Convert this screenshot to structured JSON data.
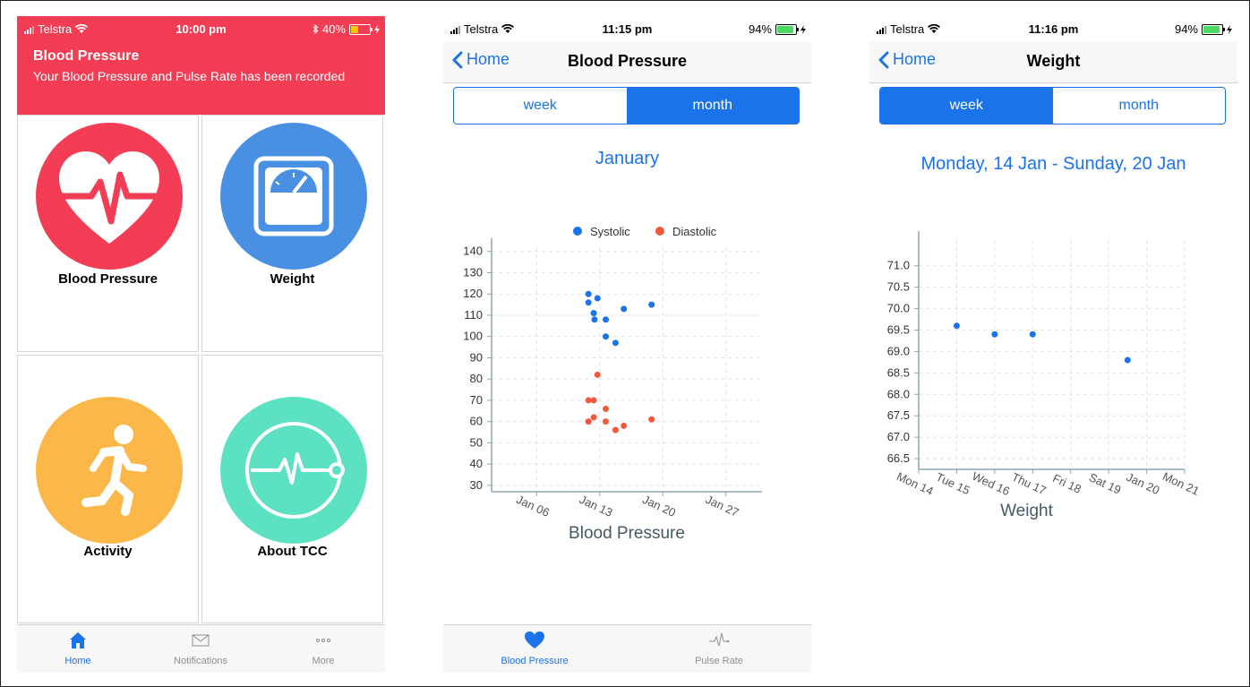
{
  "colors": {
    "accent": "#1a73e8",
    "banner": "#f23d55",
    "systolic": "#1a73e8",
    "diastolic": "#f2583e",
    "tile_bp": "#f23d55",
    "tile_weight": "#4a90e2",
    "tile_activity": "#fbb848",
    "tile_tcc": "#5ce1c2",
    "battery_low": "#ffc700",
    "battery_ok": "#4cd964"
  },
  "screens": [
    {
      "status": {
        "carrier": "Telstra",
        "time": "10:00 pm",
        "battery": "40%",
        "bluetooth": "bluetooth-icon"
      },
      "banner": {
        "title": "Blood Pressure",
        "message": "Your Blood Pressure and Pulse Rate has been recorded"
      },
      "tiles": [
        {
          "label": "Blood Pressure",
          "icon": "heart-pulse-icon"
        },
        {
          "label": "Weight",
          "icon": "scale-icon"
        },
        {
          "label": "Activity",
          "icon": "runner-icon"
        },
        {
          "label": "About TCC",
          "icon": "ecg-circle-icon"
        }
      ],
      "tabs": [
        {
          "label": "Home",
          "icon": "home-icon",
          "active": true
        },
        {
          "label": "Notifications",
          "icon": "envelope-icon",
          "active": false
        },
        {
          "label": "More",
          "icon": "more-icon",
          "active": false
        }
      ]
    },
    {
      "status": {
        "carrier": "Telstra",
        "time": "11:15 pm",
        "battery": "94%"
      },
      "nav": {
        "back": "Home",
        "title": "Blood Pressure"
      },
      "segment": [
        {
          "label": "week",
          "selected": false
        },
        {
          "label": "month",
          "selected": true
        }
      ],
      "period": "January",
      "tabs": [
        {
          "label": "Blood Pressure",
          "icon": "heart-icon",
          "active": true
        },
        {
          "label": "Pulse Rate",
          "icon": "pulse-icon",
          "active": false
        }
      ]
    },
    {
      "status": {
        "carrier": "Telstra",
        "time": "11:16 pm",
        "battery": "94%"
      },
      "nav": {
        "back": "Home",
        "title": "Weight"
      },
      "segment": [
        {
          "label": "week",
          "selected": true
        },
        {
          "label": "month",
          "selected": false
        }
      ],
      "period": "Monday, 14 Jan - Sunday, 20 Jan"
    }
  ],
  "chart_data": [
    {
      "type": "scatter",
      "title": "Blood Pressure",
      "xlabel": "Blood Pressure",
      "x_ticks": [
        "Jan 06",
        "Jan 13",
        "Jan 20",
        "Jan 27"
      ],
      "y_ticks": [
        30,
        40,
        50,
        60,
        70,
        80,
        90,
        100,
        110,
        120,
        130,
        140
      ],
      "ylim": [
        27,
        142
      ],
      "xlim": [
        "2019-01-01",
        "2019-01-31"
      ],
      "grid": true,
      "legend": "top",
      "series": [
        {
          "name": "Systolic",
          "color": "#1a73e8",
          "points": [
            {
              "x": "2019-01-11T18:00",
              "y": 120
            },
            {
              "x": "2019-01-11T18:00",
              "y": 116
            },
            {
              "x": "2019-01-12T08:00",
              "y": 111
            },
            {
              "x": "2019-01-12T10:00",
              "y": 108
            },
            {
              "x": "2019-01-12T18:00",
              "y": 118
            },
            {
              "x": "2019-01-13T16:00",
              "y": 108
            },
            {
              "x": "2019-01-13T16:00",
              "y": 100
            },
            {
              "x": "2019-01-14T18:00",
              "y": 97
            },
            {
              "x": "2019-01-15T16:00",
              "y": 113
            },
            {
              "x": "2019-01-18T18:00",
              "y": 115
            }
          ]
        },
        {
          "name": "Diastolic",
          "color": "#f2583e",
          "points": [
            {
              "x": "2019-01-11T18:00",
              "y": 70
            },
            {
              "x": "2019-01-11T18:00",
              "y": 60
            },
            {
              "x": "2019-01-12T08:00",
              "y": 70
            },
            {
              "x": "2019-01-12T08:00",
              "y": 62
            },
            {
              "x": "2019-01-12T18:00",
              "y": 82
            },
            {
              "x": "2019-01-13T16:00",
              "y": 66
            },
            {
              "x": "2019-01-13T16:00",
              "y": 60
            },
            {
              "x": "2019-01-14T18:00",
              "y": 56
            },
            {
              "x": "2019-01-15T16:00",
              "y": 58
            },
            {
              "x": "2019-01-18T18:00",
              "y": 61
            }
          ]
        }
      ]
    },
    {
      "type": "scatter",
      "title": "Weight",
      "xlabel": "Weight",
      "x_ticks": [
        "Mon 14",
        "Tue 15",
        "Wed 16",
        "Thu 17",
        "Fri 18",
        "Sat 19",
        "Jan 20",
        "Mon 21"
      ],
      "y_ticks": [
        66.5,
        67.0,
        67.5,
        68.0,
        68.5,
        69.0,
        69.5,
        70.0,
        70.5,
        71.0
      ],
      "ylim": [
        66.25,
        71.6
      ],
      "xlim": [
        "2019-01-14",
        "2019-01-21"
      ],
      "grid": true,
      "series": [
        {
          "name": "",
          "color": "#1a73e8",
          "points": [
            {
              "x": "2019-01-15",
              "y": 69.6
            },
            {
              "x": "2019-01-16",
              "y": 69.4
            },
            {
              "x": "2019-01-17",
              "y": 69.4
            },
            {
              "x": "2019-01-19T12:00",
              "y": 68.8
            }
          ]
        }
      ]
    }
  ]
}
